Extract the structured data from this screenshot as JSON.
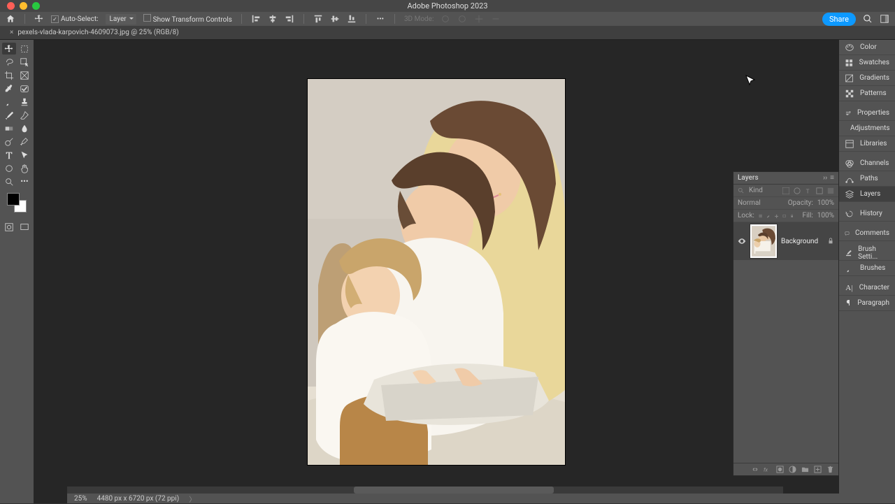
{
  "app_title": "Adobe Photoshop 2023",
  "options_bar": {
    "auto_select": "Auto-Select:",
    "auto_select_mode": "Layer",
    "show_transform": "Show Transform Controls",
    "mode_3d": "3D Mode:"
  },
  "share_label": "Share",
  "tab": {
    "filename": "pexels-vlada-karpovich-4609073.jpg @ 25% (RGB/8)"
  },
  "right_panels": [
    {
      "name": "Color"
    },
    {
      "name": "Swatches"
    },
    {
      "name": "Gradients"
    },
    {
      "name": "Patterns"
    },
    {
      "gap": true
    },
    {
      "name": "Properties"
    },
    {
      "name": "Adjustments"
    },
    {
      "name": "Libraries"
    },
    {
      "gap": true
    },
    {
      "name": "Channels"
    },
    {
      "name": "Paths"
    },
    {
      "name": "Layers",
      "active": true
    },
    {
      "gap": true
    },
    {
      "name": "History"
    },
    {
      "gap": true
    },
    {
      "name": "Comments"
    },
    {
      "gap": true
    },
    {
      "name": "Brush Setti..."
    },
    {
      "name": "Brushes"
    },
    {
      "gap": true
    },
    {
      "name": "Character"
    },
    {
      "name": "Paragraph"
    }
  ],
  "layers_panel": {
    "title": "Layers",
    "kind_label": "Kind",
    "blend_mode": "Normal",
    "opacity_label": "Opacity:",
    "opacity_value": "100%",
    "lock_label": "Lock:",
    "fill_label": "Fill:",
    "fill_value": "100%",
    "layer_name": "Background"
  },
  "status": {
    "zoom": "25%",
    "dims": "4480 px x 6720 px (72 ppi)"
  }
}
